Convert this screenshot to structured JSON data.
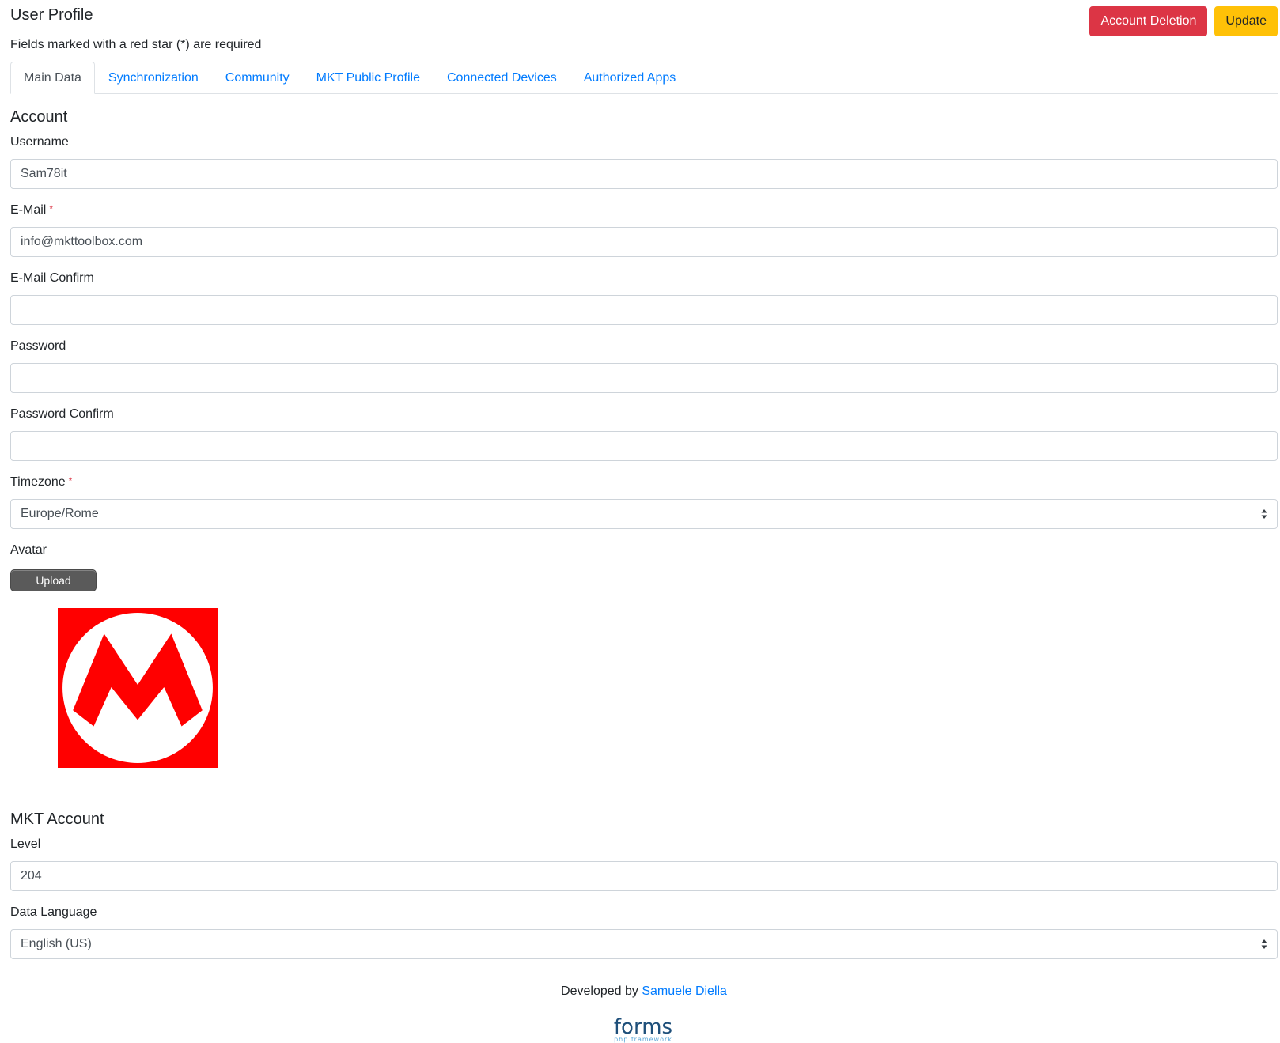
{
  "header": {
    "title": "User Profile",
    "required_note": "Fields marked with a red star (*) are required",
    "account_deletion_label": "Account Deletion",
    "update_label": "Update"
  },
  "tabs": [
    {
      "label": "Main Data",
      "active": true
    },
    {
      "label": "Synchronization",
      "active": false
    },
    {
      "label": "Community",
      "active": false
    },
    {
      "label": "MKT Public Profile",
      "active": false
    },
    {
      "label": "Connected Devices",
      "active": false
    },
    {
      "label": "Authorized Apps",
      "active": false
    }
  ],
  "account": {
    "section_title": "Account",
    "username": {
      "label": "Username",
      "value": "Sam78it"
    },
    "email": {
      "label": "E-Mail",
      "required_mark": "*",
      "value": "info@mkttoolbox.com"
    },
    "email_confirm": {
      "label": "E-Mail Confirm",
      "value": ""
    },
    "password": {
      "label": "Password",
      "value": ""
    },
    "password_confirm": {
      "label": "Password Confirm",
      "value": ""
    },
    "timezone": {
      "label": "Timezone",
      "required_mark": "*",
      "value": "Europe/Rome"
    },
    "avatar": {
      "label": "Avatar",
      "upload_label": "Upload",
      "image_icon": "mario-m-emblem"
    }
  },
  "mkt_account": {
    "section_title": "MKT Account",
    "level": {
      "label": "Level",
      "value": "204"
    },
    "data_language": {
      "label": "Data Language",
      "value": "English (US)"
    }
  },
  "footer": {
    "developed_by": "Developed by",
    "author_link": "Samuele Diella",
    "logo_word": "forms",
    "logo_subtitle": "php framework"
  },
  "colors": {
    "primary": "#007bff",
    "danger": "#dc3545",
    "warning": "#ffc107",
    "avatar_red": "#ff0000"
  }
}
